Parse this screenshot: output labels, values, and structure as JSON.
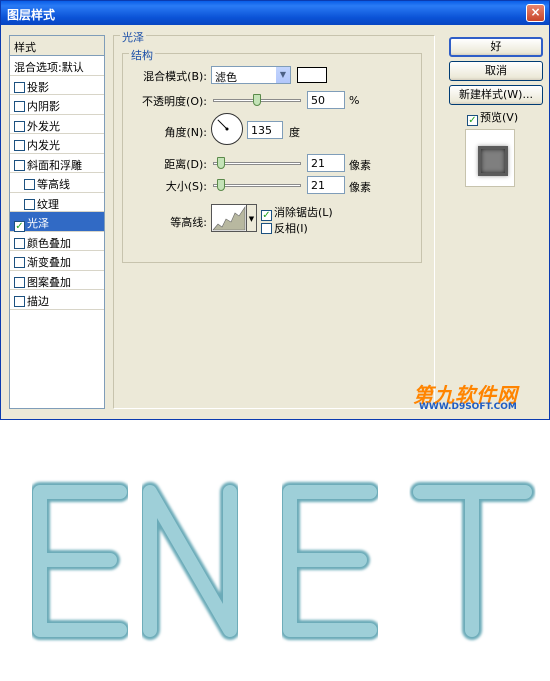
{
  "dialog": {
    "title": "图层样式",
    "close": "×"
  },
  "style_list": {
    "header": "样式",
    "items": [
      {
        "label": "混合选项:默认",
        "checkbox": false,
        "checked": false,
        "indent": false,
        "active": false
      },
      {
        "label": "投影",
        "checkbox": true,
        "checked": false,
        "indent": false,
        "active": false
      },
      {
        "label": "内阴影",
        "checkbox": true,
        "checked": false,
        "indent": false,
        "active": false
      },
      {
        "label": "外发光",
        "checkbox": true,
        "checked": false,
        "indent": false,
        "active": false
      },
      {
        "label": "内发光",
        "checkbox": true,
        "checked": false,
        "indent": false,
        "active": false
      },
      {
        "label": "斜面和浮雕",
        "checkbox": true,
        "checked": false,
        "indent": false,
        "active": false
      },
      {
        "label": "等高线",
        "checkbox": true,
        "checked": false,
        "indent": true,
        "active": false
      },
      {
        "label": "纹理",
        "checkbox": true,
        "checked": false,
        "indent": true,
        "active": false
      },
      {
        "label": "光泽",
        "checkbox": true,
        "checked": true,
        "indent": false,
        "active": true
      },
      {
        "label": "颜色叠加",
        "checkbox": true,
        "checked": false,
        "indent": false,
        "active": false
      },
      {
        "label": "渐变叠加",
        "checkbox": true,
        "checked": false,
        "indent": false,
        "active": false
      },
      {
        "label": "图案叠加",
        "checkbox": true,
        "checked": false,
        "indent": false,
        "active": false
      },
      {
        "label": "描边",
        "checkbox": true,
        "checked": false,
        "indent": false,
        "active": false
      }
    ]
  },
  "satin": {
    "group_title": "光泽",
    "structure_title": "结构",
    "blend_mode_label": "混合模式(B):",
    "blend_mode_value": "滤色",
    "swatch_color": "#ffffff",
    "opacity_label": "不透明度(O):",
    "opacity_value": "50",
    "opacity_unit": "%",
    "opacity_fraction": 0.5,
    "angle_label": "角度(N):",
    "angle_value": "135",
    "angle_unit": "度",
    "distance_label": "距离(D):",
    "distance_value": "21",
    "distance_unit": "像素",
    "distance_fraction": 0.084,
    "size_label": "大小(S):",
    "size_value": "21",
    "size_unit": "像素",
    "size_fraction": 0.084,
    "contour_label": "等高线:",
    "antialias_label": "消除锯齿(L)",
    "antialias_checked": true,
    "invert_label": "反相(I)",
    "invert_checked": false
  },
  "buttons": {
    "ok": "好",
    "cancel": "取消",
    "new_style": "新建样式(W)...",
    "preview_label": "预览(V)",
    "preview_checked": true
  },
  "watermark": {
    "logo": "第九软件网",
    "url": "WWW.D9SOFT.COM"
  },
  "canvas_text": "ENET",
  "colors": {
    "accent": "#316ac5",
    "title_bar": "#0a5ee8",
    "neon_text": "#9ecfd8",
    "neon_edge": "#6aaab8"
  }
}
